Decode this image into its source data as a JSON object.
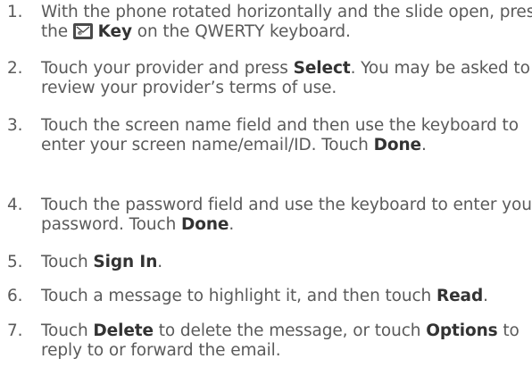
{
  "steps": [
    {
      "number": "1.",
      "t1": "With the phone rotated horizontally and the slide open, press the",
      "bold": "Key",
      "t2": "on the QWERTY keyboard.",
      "icon": "email-key-icon"
    },
    {
      "number": "2.",
      "t1": "Touch your provider and press",
      "bold": "Select",
      "t2": ". You may be asked to review your provider’s terms of use."
    },
    {
      "number": "3.",
      "t1": "Touch the screen name field and then use the keyboard to enter your screen name/email/ID. Touch",
      "bold": "Done",
      "t2": "."
    },
    {
      "number": "4.",
      "t1": "Touch the password field and use the keyboard to enter your password. Touch",
      "bold": "Done",
      "t2": "."
    },
    {
      "number": "5.",
      "t1": "Touch",
      "bold": "Sign In",
      "t2": "."
    },
    {
      "number": "6.",
      "t1": "Touch a message to highlight it, and then touch",
      "bold": "Read",
      "t2": "."
    },
    {
      "number": "7.",
      "t1": "Touch",
      "bold": "Delete",
      "t2": "to delete the message, or touch",
      "bold2": "Options",
      "t3": "to reply to or forward the email."
    }
  ]
}
